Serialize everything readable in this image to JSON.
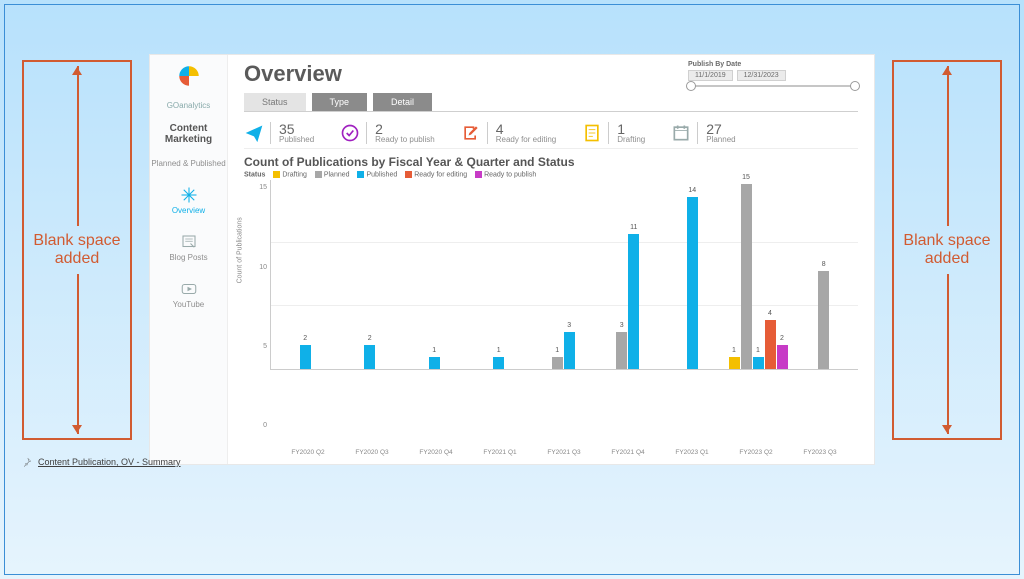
{
  "annotation_left": "Blank space added",
  "annotation_right": "Blank space added",
  "footer_label": "Content Publication, OV - Summary",
  "brand": "GOanalytics",
  "sidebar": {
    "section_title": "Content Marketing",
    "items": [
      {
        "label": "Planned & Published"
      },
      {
        "label": "Overview"
      },
      {
        "label": "Blog Posts"
      },
      {
        "label": "YouTube"
      }
    ]
  },
  "header": {
    "title": "Overview",
    "date_label": "Publish By Date",
    "date_from": "11/1/2019",
    "date_to": "12/31/2023"
  },
  "tabs": [
    {
      "label": "Status"
    },
    {
      "label": "Type"
    },
    {
      "label": "Detail"
    }
  ],
  "kpis": [
    {
      "value": "35",
      "label": "Published"
    },
    {
      "value": "2",
      "label": "Ready to publish"
    },
    {
      "value": "4",
      "label": "Ready for editing"
    },
    {
      "value": "1",
      "label": "Drafting"
    },
    {
      "value": "27",
      "label": "Planned"
    }
  ],
  "chart": {
    "title": "Count of Publications by Fiscal Year & Quarter and Status",
    "legend_title": "Status",
    "legend": [
      "Drafting",
      "Planned",
      "Published",
      "Ready for editing",
      "Ready to publish"
    ]
  },
  "chart_data": {
    "type": "bar",
    "title": "Count of Publications by Fiscal Year & Quarter and Status",
    "xlabel": "",
    "ylabel": "Count of Publications",
    "ylim": [
      0,
      15
    ],
    "yticks": [
      0,
      5,
      10,
      15
    ],
    "categories": [
      "FY2020 Q2",
      "FY2020 Q3",
      "FY2020 Q4",
      "FY2021 Q1",
      "FY2021 Q3",
      "FY2021 Q4",
      "FY2023 Q1",
      "FY2023 Q2",
      "FY2023 Q3"
    ],
    "series": [
      {
        "name": "Drafting",
        "color": "#f4bf00",
        "values": [
          0,
          0,
          0,
          0,
          0,
          0,
          0,
          1,
          0
        ]
      },
      {
        "name": "Planned",
        "color": "#a7a7a7",
        "values": [
          0,
          0,
          0,
          0,
          1,
          3,
          0,
          15,
          8
        ]
      },
      {
        "name": "Published",
        "color": "#0fb0e8",
        "values": [
          2,
          2,
          1,
          1,
          3,
          11,
          14,
          1,
          0
        ]
      },
      {
        "name": "Ready for editing",
        "color": "#e65c37",
        "values": [
          0,
          0,
          0,
          0,
          0,
          0,
          0,
          4,
          0
        ]
      },
      {
        "name": "Ready to publish",
        "color": "#c73bc6",
        "values": [
          0,
          0,
          0,
          0,
          0,
          0,
          0,
          2,
          0
        ]
      }
    ]
  }
}
